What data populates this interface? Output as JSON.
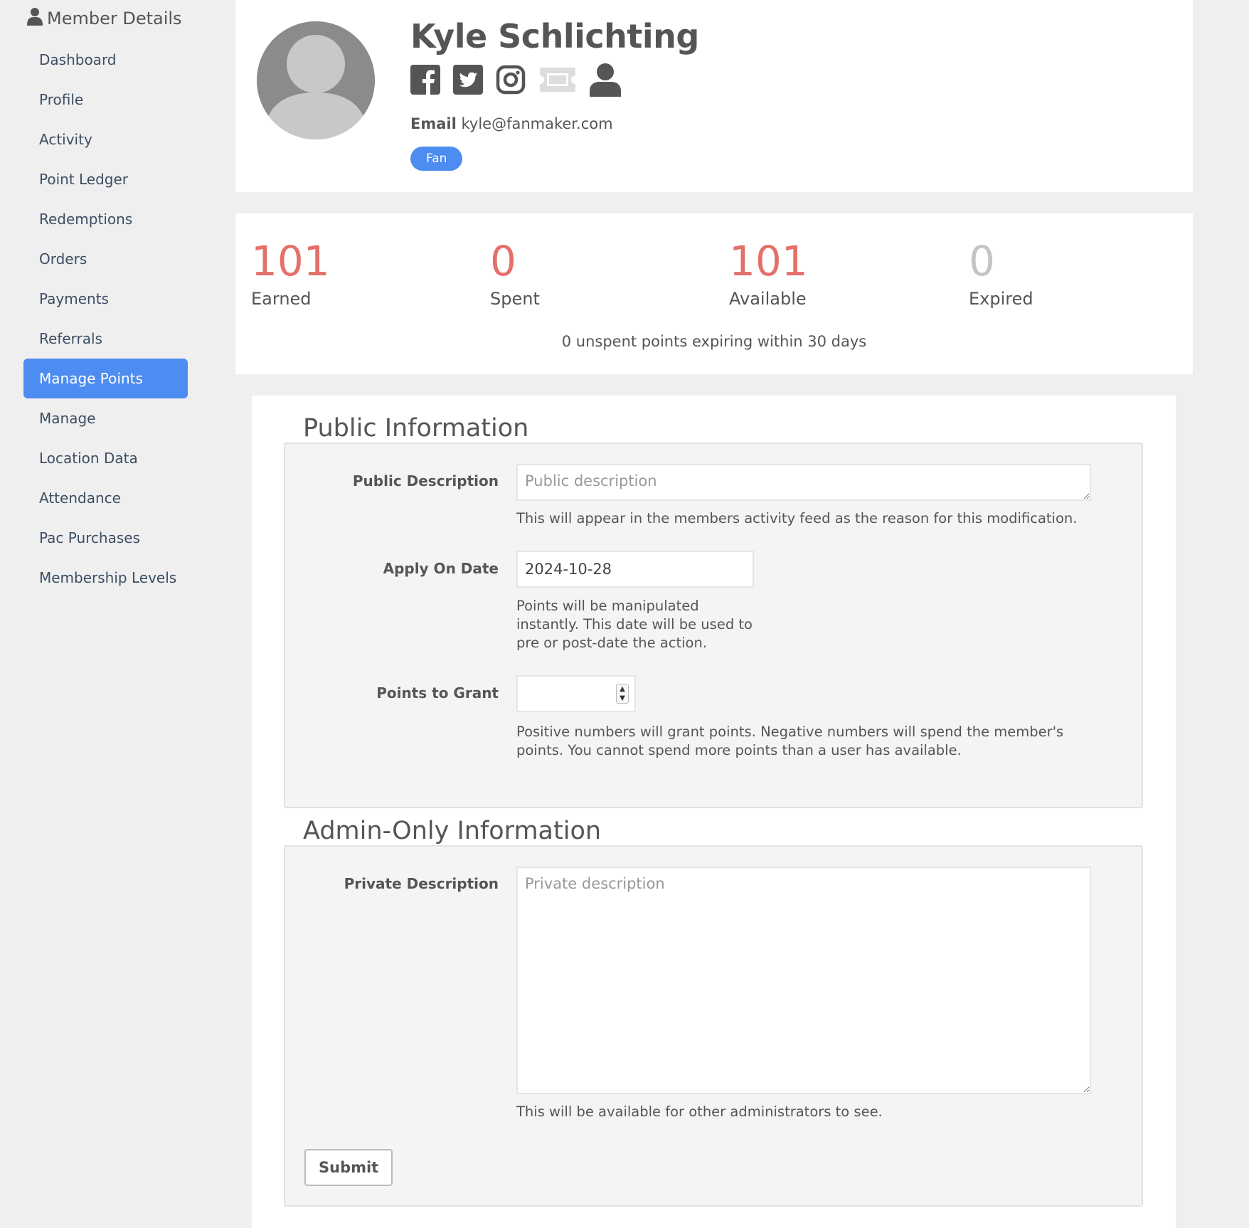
{
  "sidebar": {
    "title": "Member Details",
    "items": [
      {
        "label": "Dashboard"
      },
      {
        "label": "Profile"
      },
      {
        "label": "Activity"
      },
      {
        "label": "Point Ledger"
      },
      {
        "label": "Redemptions"
      },
      {
        "label": "Orders"
      },
      {
        "label": "Payments"
      },
      {
        "label": "Referrals"
      },
      {
        "label": "Manage Points",
        "active": true
      },
      {
        "label": "Manage"
      },
      {
        "label": "Location Data"
      },
      {
        "label": "Attendance"
      },
      {
        "label": "Pac Purchases"
      },
      {
        "label": "Membership Levels"
      }
    ],
    "active_color": "#4d8cf0"
  },
  "member": {
    "name": "Kyle Schlichting",
    "email_label": "Email",
    "email": "kyle@fanmaker.com",
    "role": "Fan",
    "social_icons": [
      "facebook-icon",
      "twitter-icon",
      "instagram-icon",
      "ticket-icon",
      "user-icon"
    ]
  },
  "stats": {
    "earned": {
      "value": "101",
      "label": "Earned"
    },
    "spent": {
      "value": "0",
      "label": "Spent"
    },
    "available": {
      "value": "101",
      "label": "Available"
    },
    "expired": {
      "value": "0",
      "label": "Expired"
    },
    "note": "0 unspent points expiring within 30 days",
    "accent_color": "#e5706a"
  },
  "form": {
    "public_section": {
      "title": "Public Information",
      "public_description": {
        "label": "Public Description",
        "placeholder": "Public description",
        "value": "",
        "help": "This will appear in the members activity feed as the reason for this modification."
      },
      "apply_on_date": {
        "label": "Apply On Date",
        "value": "2024-10-28",
        "help": "Points will be manipulated instantly. This date will be used to pre or post-date the action."
      },
      "points_to_grant": {
        "label": "Points to Grant",
        "value": "",
        "help": "Positive numbers will grant points. Negative numbers will spend the member's points. You cannot spend more points than a user has available."
      }
    },
    "admin_section": {
      "title": "Admin-Only Information",
      "private_description": {
        "label": "Private Description",
        "placeholder": "Private description",
        "value": "",
        "help": "This will be available for other administrators to see."
      }
    },
    "submit_label": "Submit"
  }
}
